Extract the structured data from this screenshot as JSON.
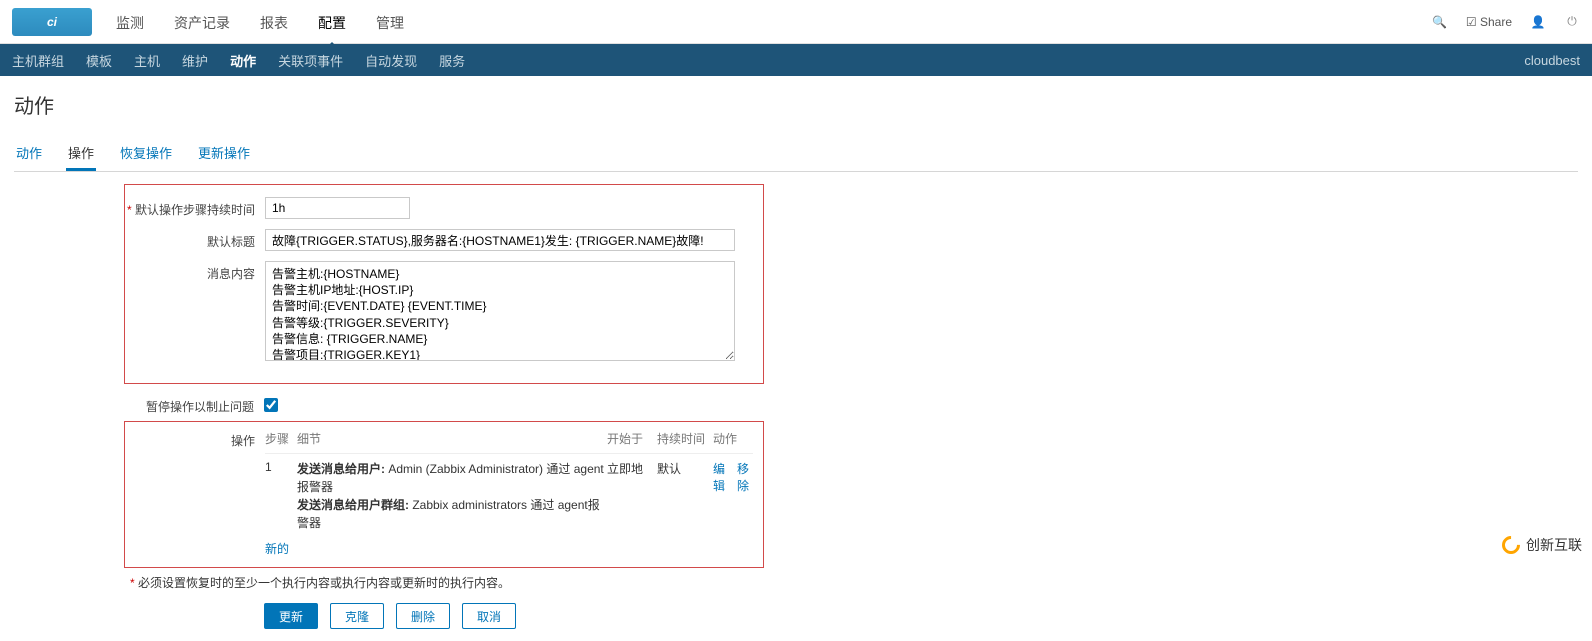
{
  "topnav": {
    "logo_text": "ci",
    "items": [
      "监测",
      "资产记录",
      "报表",
      "配置",
      "管理"
    ],
    "active_index": 3,
    "share_label": "Share"
  },
  "subnav": {
    "items": [
      "主机群组",
      "模板",
      "主机",
      "维护",
      "动作",
      "关联项事件",
      "自动发现",
      "服务"
    ],
    "active_index": 4,
    "right_text": "cloudbest"
  },
  "page_title": "动作",
  "tabs": {
    "items": [
      "动作",
      "操作",
      "恢复操作",
      "更新操作"
    ],
    "active_index": 1
  },
  "form": {
    "step_duration_label": "默认操作步骤持续时间",
    "step_duration_value": "1h",
    "default_title_label": "默认标题",
    "default_title_value": "故障{TRIGGER.STATUS},服务器名:{HOSTNAME1}发生: {TRIGGER.NAME}故障!",
    "message_label": "消息内容",
    "message_value": "告警主机:{HOSTNAME}\n告警主机IP地址:{HOST.IP}\n告警时间:{EVENT.DATE} {EVENT.TIME}\n告警等级:{TRIGGER.SEVERITY}\n告警信息: {TRIGGER.NAME}\n告警项目:{TRIGGER.KEY1}\n",
    "pause_label": "暂停操作以制止问题",
    "pause_checked": true
  },
  "operations": {
    "label": "操作",
    "headers": {
      "step": "步骤",
      "detail": "细节",
      "start": "开始于",
      "duration": "持续时间",
      "action": "动作"
    },
    "row": {
      "step": "1",
      "detail_line1_prefix": "发送消息给用户:",
      "detail_line1_body": " Admin (Zabbix Administrator) 通过 agent报警器",
      "detail_line2_prefix": "发送消息给用户群组:",
      "detail_line2_body": " Zabbix administrators 通过 agent报警器",
      "start": "立即地",
      "duration": "默认",
      "edit": "编辑",
      "remove": "移除"
    },
    "new_link": "新的"
  },
  "hint": {
    "asterisk": "*",
    "text": " 必须设置恢复时的至少一个执行内容或执行内容或更新时的执行内容。"
  },
  "buttons": {
    "update": "更新",
    "clone": "克隆",
    "delete": "删除",
    "cancel": "取消"
  },
  "watermark": "创新互联"
}
